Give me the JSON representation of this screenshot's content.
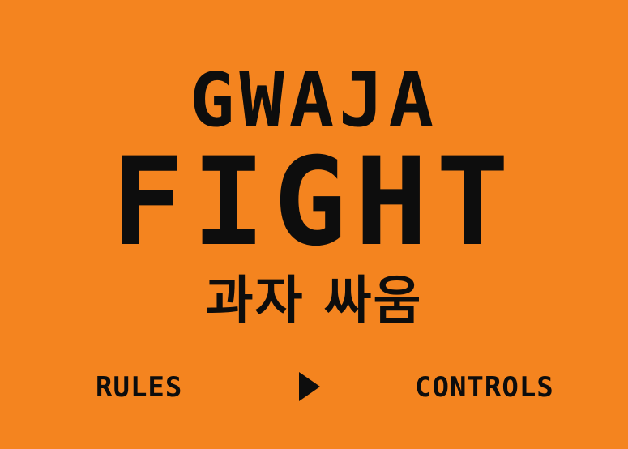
{
  "title": {
    "line1": "GWAJA",
    "line2": "FIGHT",
    "korean": "과자 싸움"
  },
  "menu": {
    "rules_label": "RULES",
    "controls_label": "CONTROLS",
    "start_icon": "play-triangle-icon"
  },
  "colors": {
    "background": "#f4841f",
    "text": "#0d0d0d"
  }
}
